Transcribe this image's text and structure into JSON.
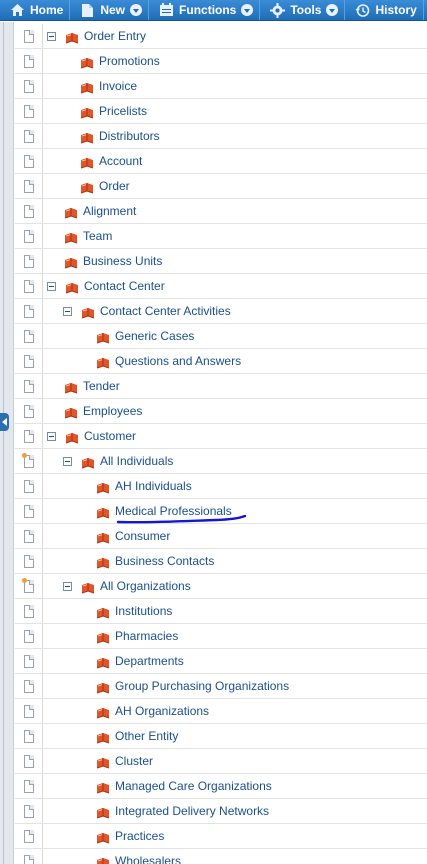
{
  "toolbar": {
    "buttons": [
      {
        "label": "Home",
        "icon": "home-icon",
        "has_dropdown": false
      },
      {
        "label": "New",
        "icon": "new-icon",
        "has_dropdown": true
      },
      {
        "label": "Functions",
        "icon": "functions-icon",
        "has_dropdown": true
      },
      {
        "label": "Tools",
        "icon": "gear-icon",
        "has_dropdown": true
      },
      {
        "label": "History",
        "icon": "history-icon",
        "has_dropdown": false
      }
    ]
  },
  "tree": {
    "rows": [
      {
        "label": "Order Entry",
        "level": 1,
        "expanded": true
      },
      {
        "label": "Promotions",
        "level": 2
      },
      {
        "label": "Invoice",
        "level": 2
      },
      {
        "label": "Pricelists",
        "level": 2
      },
      {
        "label": "Distributors",
        "level": 2
      },
      {
        "label": "Account",
        "level": 2
      },
      {
        "label": "Order",
        "level": 2
      },
      {
        "label": "Alignment",
        "level": 1
      },
      {
        "label": "Team",
        "level": 1
      },
      {
        "label": "Business Units",
        "level": 1
      },
      {
        "label": "Contact Center",
        "level": 1,
        "expanded": true
      },
      {
        "label": "Contact Center Activities",
        "level": 2,
        "expanded": true
      },
      {
        "label": "Generic Cases",
        "level": 3
      },
      {
        "label": "Questions and Answers",
        "level": 3
      },
      {
        "label": "Tender",
        "level": 1
      },
      {
        "label": "Employees",
        "level": 1
      },
      {
        "label": "Customer",
        "level": 1,
        "expanded": true
      },
      {
        "label": "All Individuals",
        "level": 2,
        "expanded": true,
        "new_indicator": true
      },
      {
        "label": "AH Individuals",
        "level": 3
      },
      {
        "label": "Medical Professionals",
        "level": 3,
        "annotated": true
      },
      {
        "label": "Consumer",
        "level": 3
      },
      {
        "label": "Business Contacts",
        "level": 3
      },
      {
        "label": "All Organizations",
        "level": 2,
        "expanded": true,
        "new_indicator": true
      },
      {
        "label": "Institutions",
        "level": 3
      },
      {
        "label": "Pharmacies",
        "level": 3
      },
      {
        "label": "Departments",
        "level": 3
      },
      {
        "label": "Group Purchasing Organizations",
        "level": 3
      },
      {
        "label": "AH Organizations",
        "level": 3
      },
      {
        "label": "Other Entity",
        "level": 3
      },
      {
        "label": "Cluster",
        "level": 3
      },
      {
        "label": "Managed Care Organizations",
        "level": 3
      },
      {
        "label": "Integrated Delivery Networks",
        "level": 3
      },
      {
        "label": "Practices",
        "level": 3
      },
      {
        "label": "Wholesalers",
        "level": 3
      }
    ]
  },
  "colors": {
    "toolbar": "#1f6db8",
    "link_text": "#1a4f8b",
    "annotation_underline": "#1515d4",
    "book_icon": "#e0552a"
  }
}
